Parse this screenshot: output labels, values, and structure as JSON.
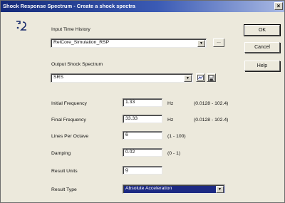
{
  "window": {
    "title": "Shock Response Spectrum - Create a shock spectra",
    "close_glyph": "×"
  },
  "icons": {
    "app": "srs-app-icon",
    "browse": "ellipsis-icon",
    "chart": "chart-icon",
    "save": "save-icon",
    "dropdown": "chevron-down-icon"
  },
  "input_time_history": {
    "label": "Input Time History",
    "value": "RelCore_Simulation_RSP",
    "browse_label": "..."
  },
  "output_shock_spectrum": {
    "label": "Output Shock Spectrum",
    "value": "SRS"
  },
  "fields": {
    "initial_frequency": {
      "label": "Initial Frequency",
      "value": "1.33",
      "unit": "Hz",
      "range": "(0.0128 - 102.4)"
    },
    "final_frequency": {
      "label": "Final Frequency",
      "value": "33.33",
      "unit": "Hz",
      "range": "(0.0128 - 102.4)"
    },
    "lines_per_octave": {
      "label": "Lines Per Octave",
      "value": "6",
      "range": "(1 - 100)"
    },
    "damping": {
      "label": "Damping",
      "value": "0.02",
      "range": "(0 - 1)"
    },
    "result_units": {
      "label": "Result Units",
      "value": "g"
    },
    "result_type": {
      "label": "Result Type",
      "value": "Absolute Acceleration"
    }
  },
  "buttons": {
    "ok": "OK",
    "cancel": "Cancel",
    "help": "Help"
  },
  "colors": {
    "titlebar": "#152b7a",
    "dialog_bg": "#ece9dc",
    "selection": "#1d2a83"
  }
}
